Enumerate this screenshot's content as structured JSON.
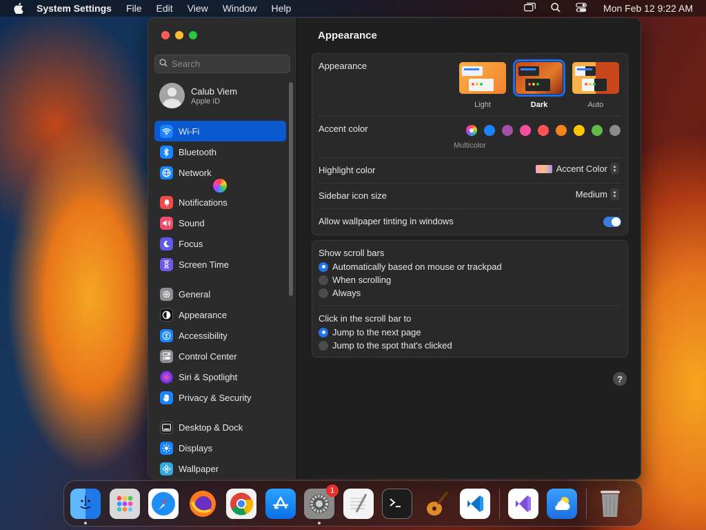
{
  "menubar": {
    "app": "System Settings",
    "menus": [
      "File",
      "Edit",
      "View",
      "Window",
      "Help"
    ],
    "clock": "Mon Feb 12  9:22 AM"
  },
  "sidebar": {
    "search_placeholder": "Search",
    "profile": {
      "name": "Calub Viem",
      "subtitle": "Apple ID"
    },
    "items": [
      {
        "label": "Wi-Fi",
        "icon": "wifi-icon",
        "color": "#1a84ff",
        "active": true
      },
      {
        "label": "Bluetooth",
        "icon": "bluetooth-icon",
        "color": "#1a84ff"
      },
      {
        "label": "Network",
        "icon": "globe-icon",
        "color": "#1a84ff"
      },
      {
        "label": "Notifications",
        "icon": "bell-icon",
        "color": "#ef4b4b"
      },
      {
        "label": "Sound",
        "icon": "speaker-icon",
        "color": "#ef4b6b"
      },
      {
        "label": "Focus",
        "icon": "moon-icon",
        "color": "#5e5ce6"
      },
      {
        "label": "Screen Time",
        "icon": "hourglass-icon",
        "color": "#6f5ce6"
      },
      {
        "label": "General",
        "icon": "gear-icon",
        "color": "#8e8e93"
      },
      {
        "label": "Appearance",
        "icon": "appearance-icon",
        "color": "#111111"
      },
      {
        "label": "Accessibility",
        "icon": "accessibility-icon",
        "color": "#1a84ff"
      },
      {
        "label": "Control Center",
        "icon": "toggles-icon",
        "color": "#8e8e93"
      },
      {
        "label": "Siri & Spotlight",
        "icon": "siri-icon",
        "color": "#a04fd6"
      },
      {
        "label": "Privacy & Security",
        "icon": "hand-icon",
        "color": "#1a84ff"
      },
      {
        "label": "Desktop & Dock",
        "icon": "dock-icon",
        "color": "#222222"
      },
      {
        "label": "Displays",
        "icon": "sun-icon",
        "color": "#1a84ff"
      },
      {
        "label": "Wallpaper",
        "icon": "flower-icon",
        "color": "#34aadc"
      }
    ]
  },
  "content": {
    "title": "Appearance",
    "appearance": {
      "label": "Appearance",
      "options": [
        {
          "label": "Light",
          "selected": false
        },
        {
          "label": "Dark",
          "selected": true
        },
        {
          "label": "Auto",
          "selected": false
        }
      ]
    },
    "accent": {
      "label": "Accent color",
      "caption": "Multicolor",
      "colors": [
        "#1a84ff",
        "#a550a7",
        "#f74f9e",
        "#ff5257",
        "#f7821b",
        "#ffc600",
        "#62ba46",
        "#8c8c8c"
      ]
    },
    "highlight": {
      "label": "Highlight color",
      "value": "Accent Color"
    },
    "sidebar_icon": {
      "label": "Sidebar icon size",
      "value": "Medium"
    },
    "tinting": {
      "label": "Allow wallpaper tinting in windows",
      "enabled": true
    },
    "scroll_bars": {
      "label": "Show scroll bars",
      "options": [
        {
          "label": "Automatically based on mouse or trackpad",
          "selected": true
        },
        {
          "label": "When scrolling",
          "selected": false
        },
        {
          "label": "Always",
          "selected": false
        }
      ]
    },
    "click_scroll": {
      "label": "Click in the scroll bar to",
      "options": [
        {
          "label": "Jump to the next page",
          "selected": true
        },
        {
          "label": "Jump to the spot that's clicked",
          "selected": false
        }
      ]
    },
    "help": "?"
  },
  "dock": {
    "apps": [
      {
        "name": "finder-icon",
        "color": "#2a8ef5"
      },
      {
        "name": "launchpad-icon",
        "color": "#cfcfcf"
      },
      {
        "name": "safari-icon",
        "color": "#1d8ef6"
      },
      {
        "name": "firefox-icon",
        "color": "#6b2fbf"
      },
      {
        "name": "chrome-icon",
        "color": "#ffffff"
      },
      {
        "name": "app-store-icon",
        "color": "#1b8cf5"
      },
      {
        "name": "system-settings-icon",
        "color": "#7d7d7d",
        "badge": "1"
      },
      {
        "name": "textedit-icon",
        "color": "#f4f4f4"
      },
      {
        "name": "terminal-icon",
        "color": "#1c1c1c"
      },
      {
        "name": "garageband-icon",
        "color": "#3a2a1e"
      },
      {
        "name": "vscode-icon",
        "color": "#ffffff"
      },
      {
        "name": "visual-studio-icon",
        "color": "#ffffff"
      },
      {
        "name": "weather-icon",
        "color": "#2f8ff0"
      },
      {
        "name": "trash-icon",
        "color": "#9a9a9a"
      }
    ]
  }
}
